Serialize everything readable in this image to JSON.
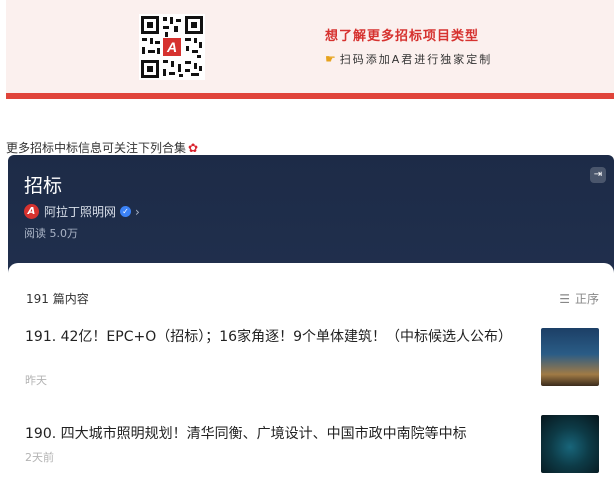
{
  "banner": {
    "title": "想了解更多招标项目类型",
    "subtitle": "扫码添加A君进行独家定制",
    "hand_icon": "pointing-hand-icon",
    "accent_color": "#e0443a"
  },
  "more_line": {
    "text": "更多招标中标信息可关注下列合集",
    "icon": "rose-icon"
  },
  "collection": {
    "title": "招标",
    "author": "阿拉丁照明网",
    "author_logo": "A",
    "reads": "阅读 5.0万",
    "count_label": "191 篇内容",
    "sort_label": "正序",
    "items": [
      {
        "title": "191. 42亿！EPC+O（招标）；16家角逐！9个单体建筑！（中标候选人公布）",
        "time": "昨天"
      },
      {
        "title": "190. 四大城市照明规划！清华同衡、广境设计、中国市政中南院等中标",
        "time": "2天前"
      }
    ]
  }
}
